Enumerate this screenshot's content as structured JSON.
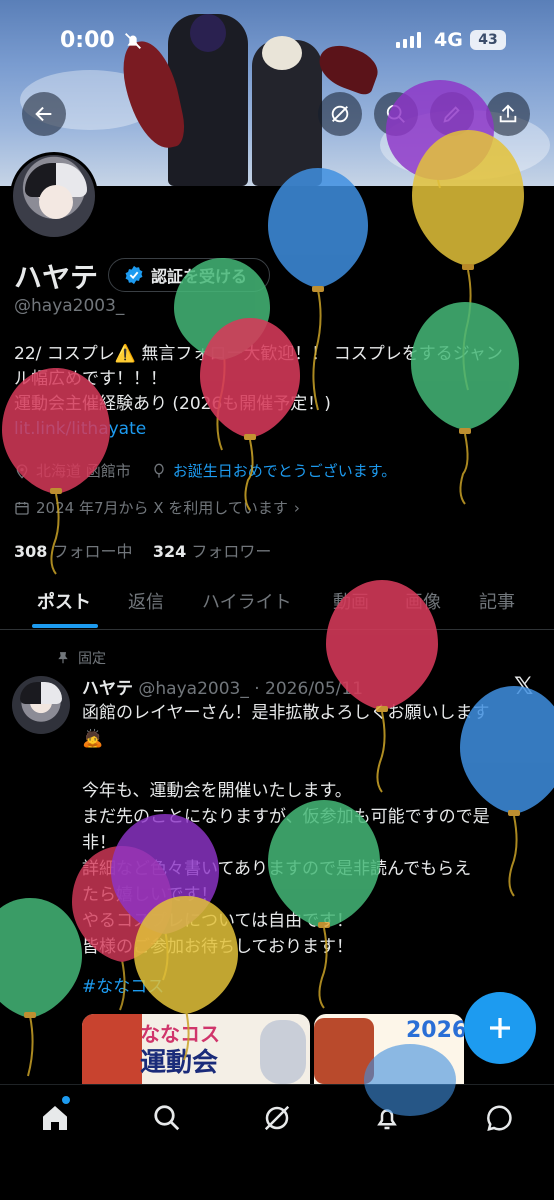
{
  "status_bar": {
    "time": "0:00",
    "network": "4G",
    "battery": "43"
  },
  "profile": {
    "name": "ハヤテ",
    "verify_label": "認証を受ける",
    "handle": "@haya2003_",
    "bio_line1": "22/ コスプレ⚠️ 無言フォロー大歓迎！！ コスプレをするジャン",
    "bio_line2": "ル幅広めです！！！",
    "bio_line3": "運動会主催経験あり (2026も開催予定！)",
    "bio_link": "lit.link/lithayate",
    "location": "北海道 函館市",
    "birthday": "お誕生日おめでとうございます。",
    "joined": "2024 年7月から X を利用しています",
    "following_count": "308",
    "following_label": "フォロー中",
    "followers_count": "324",
    "followers_label": "フォロワー"
  },
  "tabs": [
    "ポスト",
    "返信",
    "ハイライト",
    "動画",
    "画像",
    "記事"
  ],
  "post": {
    "pinned_label": "固定",
    "author": "ハヤテ",
    "meta": "@haya2003_ · 2026/05/11",
    "line1": "函館のレイヤーさん！是非拡散よろしくお願いします",
    "line2": "🙇",
    "line3": "今年も、運動会を開催いたします。",
    "line4": "まだ先のことになりますが、仮参加も可能ですので是",
    "line5": "非！",
    "line6": "詳細など色々書いてありますので是非読んでもらえ",
    "line7": "たら嬉しいです！",
    "line8": "やるコスプレについては自由です！",
    "line9": "皆様のご参加お待ちしております！",
    "hashtag": "#ななコス",
    "image1_title": "ななコス",
    "image1_sub": "運動会",
    "image2_year": "2026"
  },
  "colors": {
    "accent": "#1d9bf0",
    "background": "#000000",
    "muted": "#71767b"
  },
  "icons": {
    "back": "back-arrow-icon",
    "grok": "grok-icon",
    "search": "search-icon",
    "edit": "edit-icon",
    "share": "share-icon",
    "verified": "verified-badge-icon",
    "location": "location-icon",
    "balloon": "balloon-icon",
    "calendar": "calendar-icon",
    "pin": "pin-icon",
    "compose": "plus-icon",
    "home": "home-icon",
    "notifications": "bell-icon",
    "messages": "message-icon"
  }
}
